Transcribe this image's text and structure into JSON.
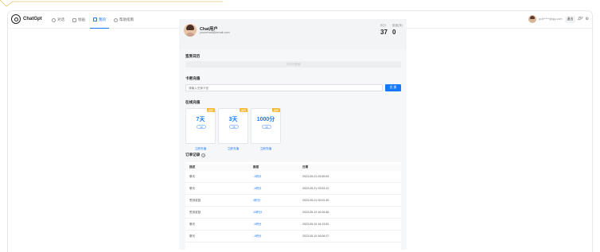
{
  "app": {
    "name": "ChatGpt"
  },
  "nav": {
    "tabs": [
      {
        "label": "对话",
        "icon": "chat-icon"
      },
      {
        "label": "绘画",
        "icon": "image-icon"
      },
      {
        "label": "我的",
        "icon": "user-icon",
        "active": true
      },
      {
        "label": "帮助指南",
        "icon": "help-icon"
      }
    ],
    "user_email": "ych*****@qq.com",
    "logout_label": "退出",
    "lang_label": "ZP"
  },
  "profile": {
    "name": "Chat用户",
    "email": "youremail@email.com",
    "points_label": "积分",
    "points_value": "37",
    "extra_label": "额度(条)",
    "extra_value": "0"
  },
  "sign": {
    "title": "签到日历",
    "button": "今日已签到"
  },
  "card_recharge": {
    "title": "卡密充值",
    "placeholder": "请输入兑换卡密",
    "button": "兑 换"
  },
  "packages": {
    "title": "在线充值",
    "items": [
      {
        "amount": "7天",
        "price": "¥9",
        "badge": "推荐",
        "buy": "立即充值"
      },
      {
        "amount": "3天",
        "price": "¥5",
        "badge": "推荐",
        "buy": "立即充值"
      },
      {
        "amount": "1000分",
        "price": "¥9",
        "badge": "推荐",
        "buy": "立即充值"
      }
    ]
  },
  "orders": {
    "title": "订单记录",
    "columns": [
      "描述",
      "额度",
      "日期"
    ],
    "rows": [
      {
        "desc": "聊天",
        "amount": "-1积分",
        "date": "2023-05-21 03:59:54"
      },
      {
        "desc": "聊天",
        "amount": "-1积分",
        "date": "2023-05-21 03:53:12"
      },
      {
        "desc": "签到奖励",
        "amount": "3积分",
        "date": "2023-05-21 00:01:45"
      },
      {
        "desc": "签到奖励",
        "amount": "10积分",
        "date": "2023-05-19 16:26:46"
      },
      {
        "desc": "聊天",
        "amount": "-1积分",
        "date": "2023-05-19 16:13:52"
      },
      {
        "desc": "聊天",
        "amount": "-1积分",
        "date": "2023-05-19 16:06:37"
      }
    ]
  },
  "colors": {
    "accent": "#1677ff",
    "badge": "#f7b733"
  }
}
